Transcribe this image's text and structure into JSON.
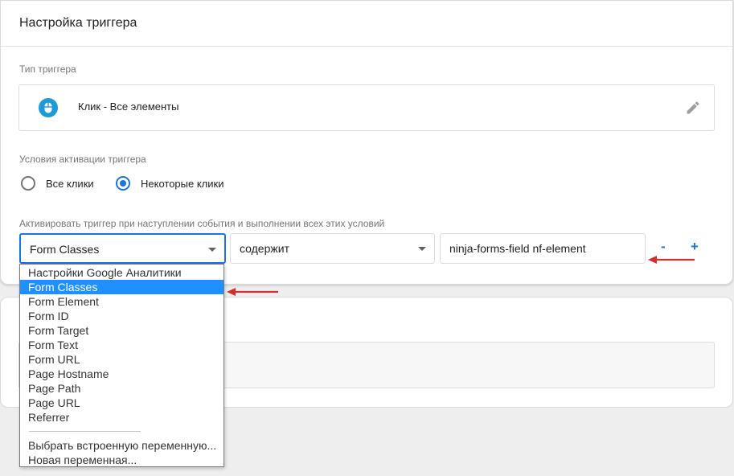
{
  "trigger_config": {
    "title": "Настройка триггера",
    "type_label": "Тип триггера",
    "type_name": "Клик - Все элементы",
    "activation_label": "Условия активации триггера",
    "radio_all": "Все клики",
    "radio_some": "Некоторые клики",
    "radio_selected": "some",
    "condition_label": "Активировать триггер при наступлении события и выполнении всех этих условий",
    "condition": {
      "variable": "Form Classes",
      "operator": "содержит",
      "value": "ninja-forms-field nf-element"
    },
    "remove_label": "-",
    "add_label": "+"
  },
  "dropdown": {
    "items": [
      "Настройки Google Аналитики",
      "Form Classes",
      "Form Element",
      "Form ID",
      "Form Target",
      "Form Text",
      "Form URL",
      "Page Hostname",
      "Page Path",
      "Page URL",
      "Referrer"
    ],
    "selected_index": 1,
    "footer_items": [
      "Выбрать встроенную переменную...",
      "Новая переменная..."
    ]
  },
  "colors": {
    "accent": "#1a73e8",
    "selected_bg": "#1e90ff",
    "annotation_arrow": "#d32f2f",
    "icon_bg": "#1e9ad6"
  },
  "icons": {
    "type": "mouse-icon",
    "edit": "pencil-icon",
    "caret": "caret-down-icon"
  }
}
